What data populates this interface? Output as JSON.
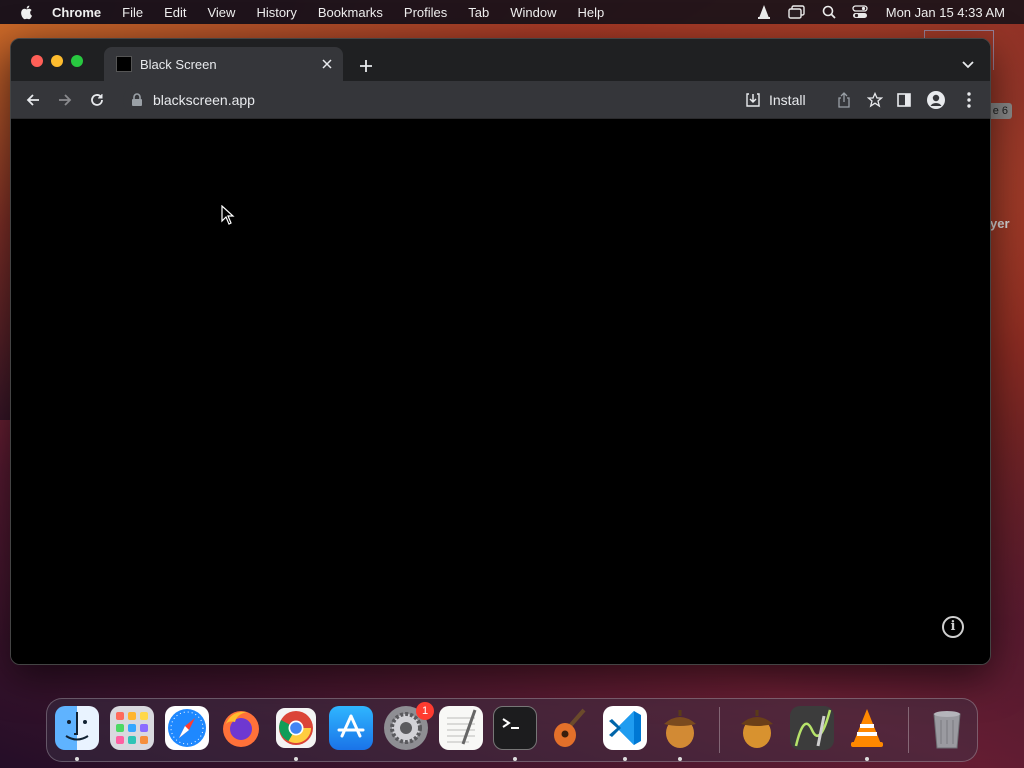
{
  "menubar": {
    "app_name": "Chrome",
    "menus": [
      "File",
      "Edit",
      "View",
      "History",
      "Bookmarks",
      "Profiles",
      "Tab",
      "Window",
      "Help"
    ],
    "status_icons": [
      "vlc-icon",
      "screen-mirror-icon",
      "spotlight-search-icon",
      "control-center-icon"
    ],
    "clock": "Mon Jan 15  4:33 AM"
  },
  "desktop": {
    "badge_text": "e 6",
    "label_text": "yer"
  },
  "browser": {
    "tab": {
      "title": "Black Screen"
    },
    "address": {
      "url": "blackscreen.app"
    },
    "install_label": "Install",
    "page": {
      "background": "#000000"
    }
  },
  "dock": {
    "apps": [
      {
        "name": "finder-icon",
        "running": true
      },
      {
        "name": "launchpad-icon",
        "running": false
      },
      {
        "name": "safari-icon",
        "running": false
      },
      {
        "name": "firefox-icon",
        "running": false
      },
      {
        "name": "chrome-icon",
        "running": true
      },
      {
        "name": "app-store-icon",
        "running": false
      },
      {
        "name": "system-settings-icon",
        "running": false,
        "badge": "1"
      },
      {
        "name": "textedit-icon",
        "running": false
      },
      {
        "name": "terminal-icon",
        "running": true
      },
      {
        "name": "garageband-icon",
        "running": false
      },
      {
        "name": "vscode-icon",
        "running": true
      },
      {
        "name": "acorn-icon",
        "running": true
      },
      {
        "name": "acorn-download-icon",
        "running": false
      },
      {
        "name": "grapher-icon",
        "running": false
      },
      {
        "name": "vlc-icon",
        "running": true
      },
      {
        "name": "trash-icon",
        "running": false
      }
    ]
  },
  "colors": {
    "tab_bg": "#35363a",
    "tabstrip_bg": "#1f2022",
    "close": "#ff5f57",
    "minimize": "#febc2e",
    "maximize": "#28c840",
    "badge": "#ff3b30"
  }
}
